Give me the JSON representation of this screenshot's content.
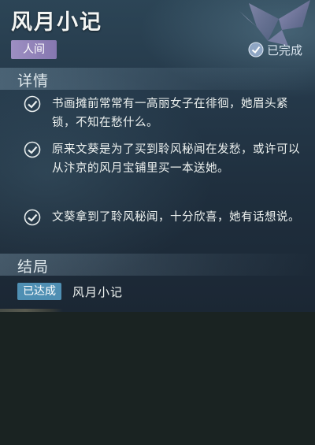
{
  "quest": {
    "title": "风月小记",
    "category": "人间",
    "status_label": "已完成"
  },
  "details": {
    "heading": "详情",
    "items": [
      "书画摊前常常有一高丽女子在徘徊，她眉头紧锁，不知在愁什么。",
      "原来文葵是为了买到聆风秘闻在发愁，或许可以从汴京的风月宝铺里买一本送她。",
      "文葵拿到了聆风秘闻，十分欣喜，她有话想说。"
    ]
  },
  "ending": {
    "heading": "结局",
    "badge": "已达成",
    "name": "风月小记"
  },
  "icons": {
    "emblem": "butterfly-emblem-icon",
    "status": "check-circle-icon",
    "item": "check-icon"
  },
  "colors": {
    "category_tag": "#9d8fc2",
    "ending_badge": "#4f8fb3"
  }
}
